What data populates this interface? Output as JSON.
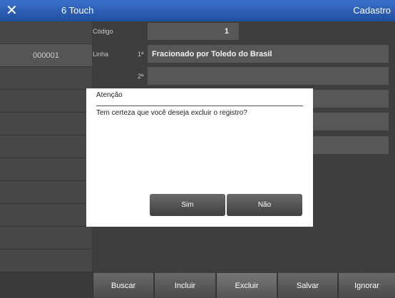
{
  "titlebar": {
    "close_icon": "close-icon",
    "app_title": "6 Touch",
    "screen_title": "Cadastro"
  },
  "sidebar": {
    "rows": [
      "",
      "000001",
      "",
      "",
      "",
      "",
      "",
      "",
      "",
      "",
      ""
    ]
  },
  "form": {
    "codigo_label": "Código",
    "codigo_value": "1",
    "linha_label": "Linha",
    "linha1_index": "1ª",
    "linha1_value": "Fracionado por Toledo do Brasil",
    "linha2_index": "2ª",
    "linha2_value": ""
  },
  "toolbar": {
    "buscar": "Buscar",
    "incluir": "Incluir",
    "excluir": "Excluir",
    "salvar": "Salvar",
    "ignorar": "Ignorar"
  },
  "dialog": {
    "title": "Atenção",
    "message": "Tem certeza que você deseja excluir o registro?",
    "yes_label": "Sim",
    "no_label": "Não"
  },
  "colors": {
    "titlebar": "#2a5bb0",
    "dialog_bg": "#ffffff",
    "panel": "#3e3e3e"
  }
}
